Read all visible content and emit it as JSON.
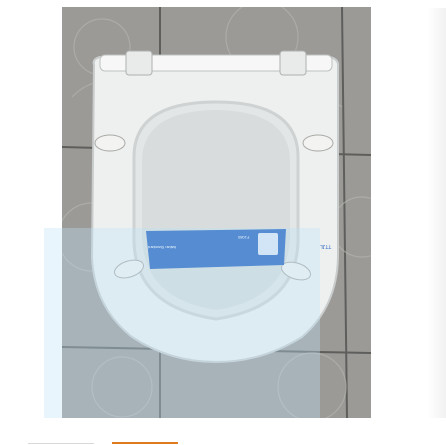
{
  "product_image": {
    "label_text_brand": "TTJL",
    "label_text_left": "Italian Standard",
    "label_text_right": "F1080"
  },
  "thumbnail_tabs": [
    {
      "label": "",
      "active": false
    },
    {
      "label": "",
      "active": true
    }
  ],
  "colors": {
    "accent": "#e07a1f",
    "label_blue": "#1f5fbf",
    "seat_white": "#f3f4f4",
    "tile_gray": "#9b9a97"
  }
}
